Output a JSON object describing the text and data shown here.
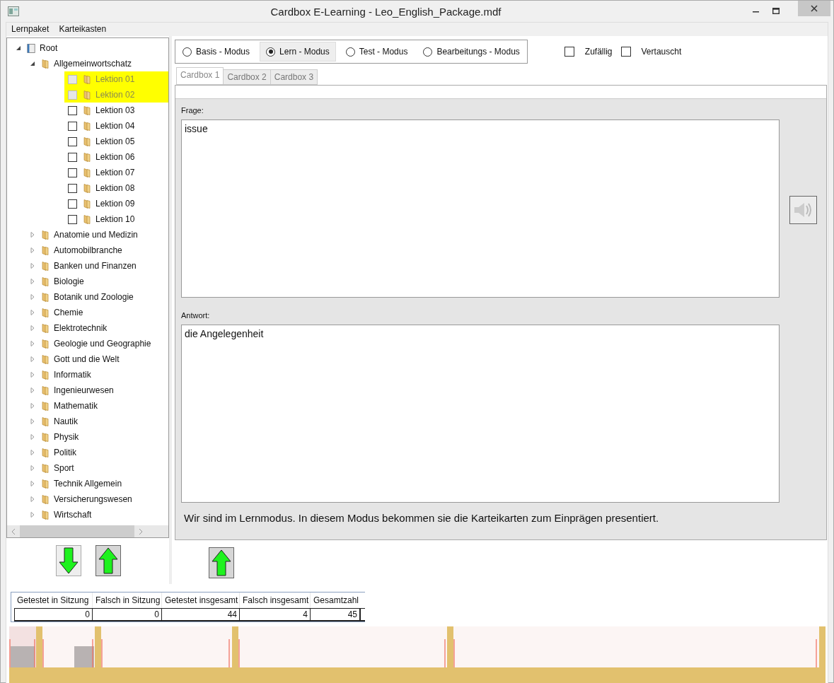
{
  "window": {
    "title": "Cardbox E-Learning - Leo_English_Package.mdf"
  },
  "menu": [
    "Lernpaket",
    "Karteikasten"
  ],
  "tree": [
    {
      "label": "Root",
      "kind": "root",
      "expanded": true,
      "children": [
        {
          "label": "Allgemeinwortschatz",
          "kind": "folder",
          "expanded": true,
          "children": [
            {
              "label": "Lektion 01",
              "kind": "lesson",
              "checked": false,
              "selected": true
            },
            {
              "label": "Lektion 02",
              "kind": "lesson",
              "checked": false,
              "selected": true
            },
            {
              "label": "Lektion 03",
              "kind": "lesson",
              "checked": false,
              "selected": false
            },
            {
              "label": "Lektion 04",
              "kind": "lesson",
              "checked": false,
              "selected": false
            },
            {
              "label": "Lektion 05",
              "kind": "lesson",
              "checked": false,
              "selected": false
            },
            {
              "label": "Lektion 06",
              "kind": "lesson",
              "checked": false,
              "selected": false
            },
            {
              "label": "Lektion 07",
              "kind": "lesson",
              "checked": false,
              "selected": false
            },
            {
              "label": "Lektion 08",
              "kind": "lesson",
              "checked": false,
              "selected": false
            },
            {
              "label": "Lektion 09",
              "kind": "lesson",
              "checked": false,
              "selected": false
            },
            {
              "label": "Lektion 10",
              "kind": "lesson",
              "checked": false,
              "selected": false
            }
          ]
        },
        {
          "label": "Anatomie und Medizin",
          "kind": "folder",
          "expanded": false
        },
        {
          "label": "Automobilbranche",
          "kind": "folder",
          "expanded": false
        },
        {
          "label": "Banken und Finanzen",
          "kind": "folder",
          "expanded": false
        },
        {
          "label": "Biologie",
          "kind": "folder",
          "expanded": false
        },
        {
          "label": "Botanik und Zoologie",
          "kind": "folder",
          "expanded": false
        },
        {
          "label": "Chemie",
          "kind": "folder",
          "expanded": false
        },
        {
          "label": "Elektrotechnik",
          "kind": "folder",
          "expanded": false
        },
        {
          "label": "Geologie und Geographie",
          "kind": "folder",
          "expanded": false
        },
        {
          "label": "Gott und die Welt",
          "kind": "folder",
          "expanded": false
        },
        {
          "label": "Informatik",
          "kind": "folder",
          "expanded": false
        },
        {
          "label": "Ingenieurwesen",
          "kind": "folder",
          "expanded": false
        },
        {
          "label": "Mathematik",
          "kind": "folder",
          "expanded": false
        },
        {
          "label": "Nautik",
          "kind": "folder",
          "expanded": false
        },
        {
          "label": "Physik",
          "kind": "folder",
          "expanded": false
        },
        {
          "label": "Politik",
          "kind": "folder",
          "expanded": false
        },
        {
          "label": "Sport",
          "kind": "folder",
          "expanded": false
        },
        {
          "label": "Technik Allgemein",
          "kind": "folder",
          "expanded": false
        },
        {
          "label": "Versicherungswesen",
          "kind": "folder",
          "expanded": false
        },
        {
          "label": "Wirtschaft",
          "kind": "folder",
          "expanded": false
        }
      ]
    }
  ],
  "modes": [
    {
      "label": "Basis - Modus",
      "selected": false
    },
    {
      "label": "Lern - Modus",
      "selected": true
    },
    {
      "label": "Test - Modus",
      "selected": false
    },
    {
      "label": "Bearbeitungs - Modus",
      "selected": false
    }
  ],
  "options": [
    {
      "label": "Zufällig",
      "checked": false
    },
    {
      "label": "Vertauscht",
      "checked": false
    }
  ],
  "tabs": [
    {
      "label": "Cardbox 1",
      "selected": true
    },
    {
      "label": "Cardbox 2",
      "selected": false
    },
    {
      "label": "Cardbox 3",
      "selected": false
    }
  ],
  "card": {
    "question_label": "Frage:",
    "question": "issue",
    "answer_label": "Antwort:",
    "answer": "die Angelegenheit",
    "hint": "Wir sind im Lernmodus. In diesem Modus bekommen sie die Karteikarten zum Einprägen presentiert."
  },
  "stats": {
    "columns": [
      "Getestet in Sitzung",
      "Falsch in Sitzung",
      "Getestet insgesamt",
      "Falsch insgesamt",
      "Gesamtzahl"
    ],
    "values": [
      "0",
      "0",
      "44",
      "4",
      "45"
    ]
  }
}
